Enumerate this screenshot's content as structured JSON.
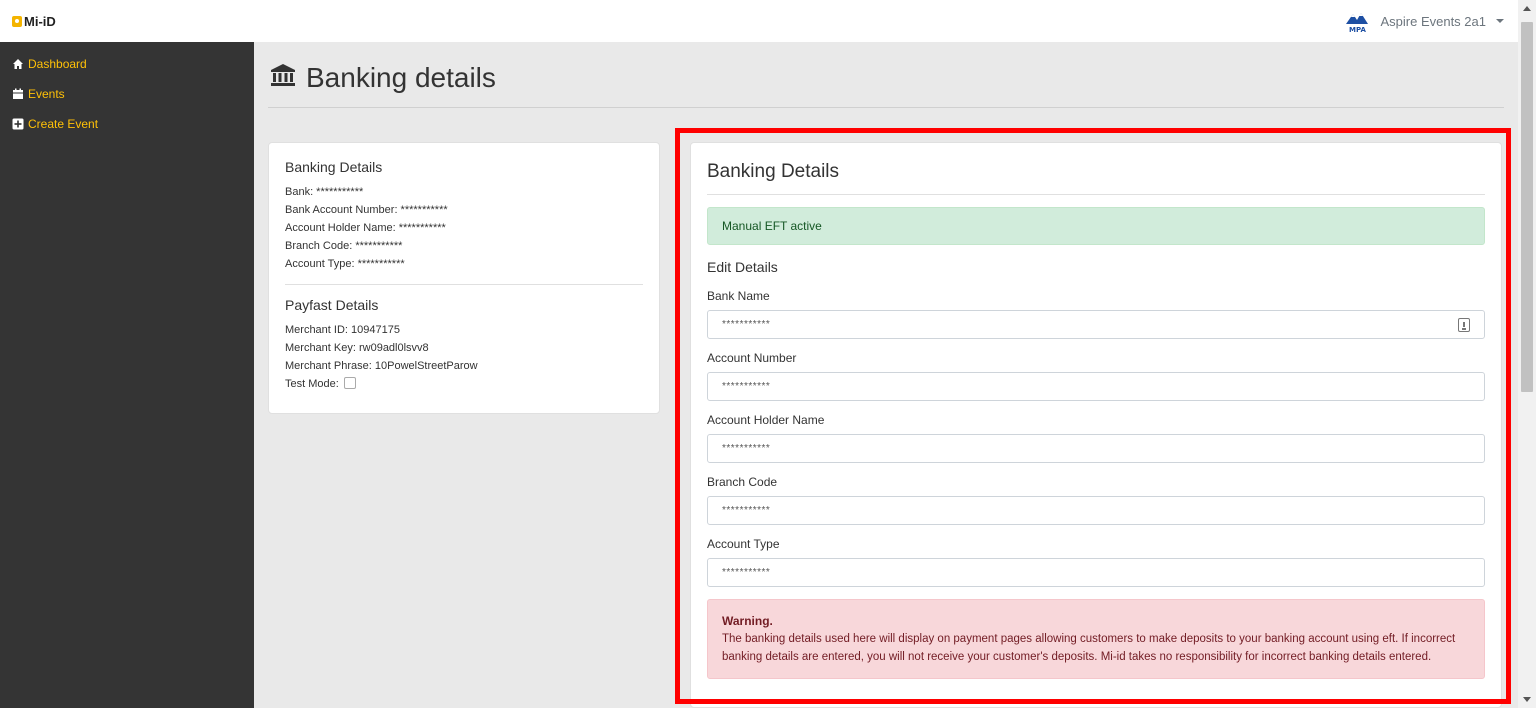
{
  "app": {
    "logo_text": "Mi-iD"
  },
  "user": {
    "name": "Aspire Events 2a1",
    "avatar_label": "MPA"
  },
  "sidebar": {
    "items": [
      {
        "label": "Dashboard",
        "icon": "home-icon"
      },
      {
        "label": "Events",
        "icon": "calendar-icon"
      },
      {
        "label": "Create Event",
        "icon": "plus-square-icon"
      }
    ]
  },
  "page": {
    "title": "Banking details",
    "title_icon": "bank-icon"
  },
  "summary": {
    "banking_title": "Banking Details",
    "bank": "Bank: ***********",
    "account_number": "Bank Account Number: ***********",
    "holder_name": "Account Holder Name: ***********",
    "branch_code": "Branch Code: ***********",
    "account_type": "Account Type: ***********",
    "payfast_title": "Payfast Details",
    "merchant_id": "Merchant ID: 10947175",
    "merchant_key": "Merchant Key: rw09adl0lsvv8",
    "merchant_phrase": "Merchant Phrase: 10PowelStreetParow",
    "test_mode": "Test Mode:"
  },
  "form": {
    "title": "Banking Details",
    "status": "Manual EFT active",
    "edit_title": "Edit Details",
    "fields": [
      {
        "label": "Bank Name",
        "value": "***********"
      },
      {
        "label": "Account Number",
        "value": "***********"
      },
      {
        "label": "Account Holder Name",
        "value": "***********"
      },
      {
        "label": "Branch Code",
        "value": "***********"
      },
      {
        "label": "Account Type",
        "value": "***********"
      }
    ],
    "warning_title": "Warning.",
    "warning_text": "The banking details used here will display on payment pages allowing customers to make deposits to your banking account using eft. If incorrect banking details are entered, you will not receive your customer's deposits. Mi-id takes no responsibility for incorrect banking details entered."
  },
  "colors": {
    "accent": "#ffc107",
    "sidebar_bg": "#343434",
    "highlight": "#ff0000"
  }
}
